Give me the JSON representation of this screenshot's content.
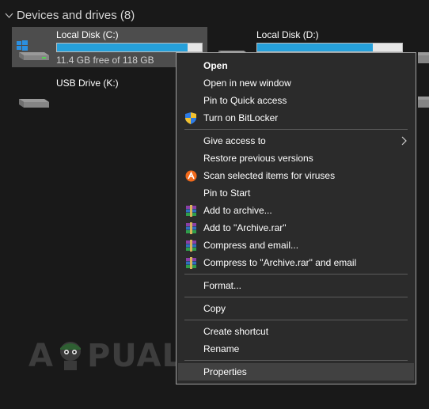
{
  "section": {
    "title": "Devices and drives (8)"
  },
  "drives": [
    {
      "name": "Local Disk (C:)",
      "free_text": "11.4 GB free of 118 GB",
      "used_fraction": 0.9
    },
    {
      "name": "Local Disk (D:)",
      "used_fraction": 0.8
    },
    {
      "name": "USB Drive (K:)"
    }
  ],
  "menu": {
    "items": [
      {
        "label": "Open",
        "icon": ""
      },
      {
        "label": "Open in new window",
        "icon": ""
      },
      {
        "label": "Pin to Quick access",
        "icon": ""
      },
      {
        "label": "Turn on BitLocker",
        "icon": "shield-icon"
      },
      {
        "label": "Give access to",
        "icon": "",
        "submenu": true
      },
      {
        "label": "Restore previous versions",
        "icon": ""
      },
      {
        "label": "Scan selected items for viruses",
        "icon": "avast-icon"
      },
      {
        "label": "Pin to Start",
        "icon": ""
      },
      {
        "label": "Add to archive...",
        "icon": "winrar-icon"
      },
      {
        "label": "Add to \"Archive.rar\"",
        "icon": "winrar-icon"
      },
      {
        "label": "Compress and email...",
        "icon": "winrar-icon"
      },
      {
        "label": "Compress to \"Archive.rar\" and email",
        "icon": "winrar-icon"
      },
      {
        "label": "Format...",
        "icon": ""
      },
      {
        "label": "Copy",
        "icon": ""
      },
      {
        "label": "Create shortcut",
        "icon": ""
      },
      {
        "label": "Rename",
        "icon": ""
      },
      {
        "label": "Properties",
        "icon": ""
      }
    ]
  },
  "watermark": {
    "text": "A  PUALS"
  },
  "colors": {
    "accent": "#26a0da",
    "background": "#191919",
    "menu": "#2b2b2b",
    "highlight": "#414141"
  }
}
